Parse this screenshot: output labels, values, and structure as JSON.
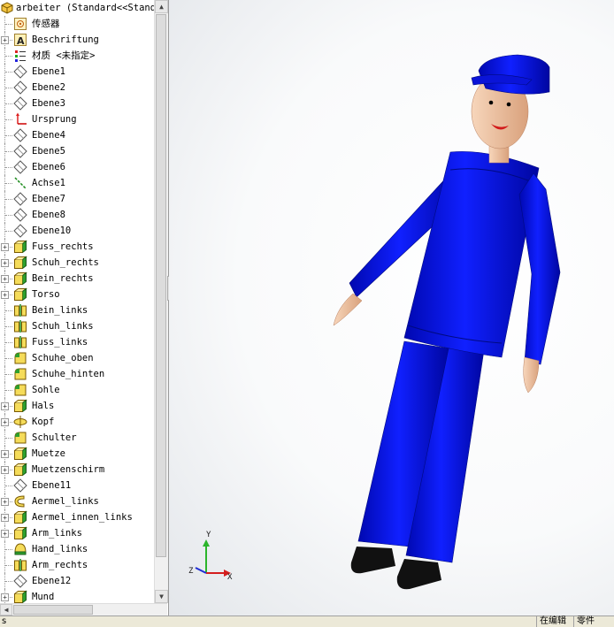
{
  "tree": {
    "root_label": "arbeiter  (Standard<<Stand",
    "items": [
      {
        "label": "传感器",
        "icon": "sensor-icon",
        "expandable": false
      },
      {
        "label": "Beschriftung",
        "icon": "annotation-icon",
        "expandable": true
      },
      {
        "label": "材质 <未指定>",
        "icon": "material-icon",
        "expandable": false
      },
      {
        "label": "Ebene1",
        "icon": "plane-icon",
        "expandable": false
      },
      {
        "label": "Ebene2",
        "icon": "plane-icon",
        "expandable": false
      },
      {
        "label": "Ebene3",
        "icon": "plane-icon",
        "expandable": false
      },
      {
        "label": "Ursprung",
        "icon": "origin-icon",
        "expandable": false
      },
      {
        "label": "Ebene4",
        "icon": "plane-icon",
        "expandable": false
      },
      {
        "label": "Ebene5",
        "icon": "plane-icon",
        "expandable": false
      },
      {
        "label": "Ebene6",
        "icon": "plane-icon",
        "expandable": false
      },
      {
        "label": "Achse1",
        "icon": "axis-icon",
        "expandable": false
      },
      {
        "label": "Ebene7",
        "icon": "plane-icon",
        "expandable": false
      },
      {
        "label": "Ebene8",
        "icon": "plane-icon",
        "expandable": false
      },
      {
        "label": "Ebene10",
        "icon": "plane-icon",
        "expandable": false
      },
      {
        "label": "Fuss_rechts",
        "icon": "extrude-icon",
        "expandable": true
      },
      {
        "label": "Schuh_rechts",
        "icon": "extrude-icon",
        "expandable": true
      },
      {
        "label": "Bein_rechts",
        "icon": "extrude-icon",
        "expandable": true
      },
      {
        "label": "Torso",
        "icon": "extrude-icon",
        "expandable": true
      },
      {
        "label": "Bein_links",
        "icon": "mirror-icon",
        "expandable": false
      },
      {
        "label": "Schuh_links",
        "icon": "mirror-icon",
        "expandable": false
      },
      {
        "label": "Fuss_links",
        "icon": "mirror-icon",
        "expandable": false
      },
      {
        "label": "Schuhe_oben",
        "icon": "fillet-icon",
        "expandable": false
      },
      {
        "label": "Schuhe_hinten",
        "icon": "fillet-icon",
        "expandable": false
      },
      {
        "label": "Sohle",
        "icon": "fillet-icon",
        "expandable": false
      },
      {
        "label": "Hals",
        "icon": "extrude-icon",
        "expandable": true
      },
      {
        "label": "Kopf",
        "icon": "revolve-icon",
        "expandable": true
      },
      {
        "label": "Schulter",
        "icon": "fillet-icon",
        "expandable": false
      },
      {
        "label": "Muetze",
        "icon": "extrude-icon",
        "expandable": true
      },
      {
        "label": "Muetzenschirm",
        "icon": "extrude-icon",
        "expandable": true
      },
      {
        "label": "Ebene11",
        "icon": "plane-icon",
        "expandable": false
      },
      {
        "label": "Aermel_links",
        "icon": "sweep-icon",
        "expandable": true
      },
      {
        "label": "Aermel_innen_links",
        "icon": "extrude-icon",
        "expandable": true
      },
      {
        "label": "Arm_links",
        "icon": "extrude-icon",
        "expandable": true
      },
      {
        "label": "Hand_links",
        "icon": "dome-icon",
        "expandable": false
      },
      {
        "label": "Arm_rechts",
        "icon": "mirror-icon",
        "expandable": false
      },
      {
        "label": "Ebene12",
        "icon": "plane-icon",
        "expandable": false
      },
      {
        "label": "Mund",
        "icon": "extrude-icon",
        "expandable": true
      }
    ]
  },
  "triad": {
    "x": "X",
    "y": "Y",
    "z": "Z"
  },
  "status": {
    "editing": "在编辑",
    "mode": "零件"
  },
  "colors": {
    "body_blue": "#0a16f0",
    "body_dark": "#0008b8",
    "skin": "#f2c8a6",
    "shoe": "#111111",
    "selection": "#316ac5"
  }
}
